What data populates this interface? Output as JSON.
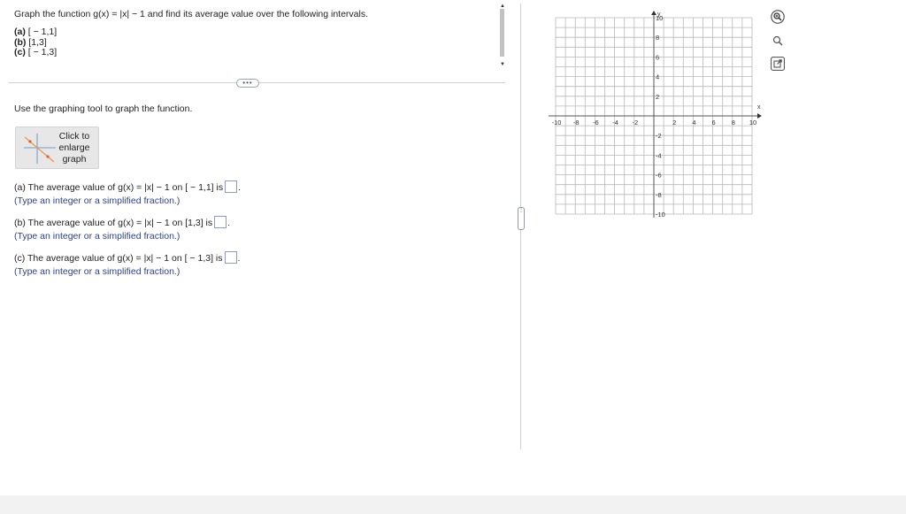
{
  "problem": {
    "statement": "Graph the function g(x) = |x| − 1 and find its average value over the following intervals.",
    "intervals": [
      {
        "label": "(a)",
        "value": "[ − 1,1]"
      },
      {
        "label": "(b)",
        "value": "[1,3]"
      },
      {
        "label": "(c)",
        "value": "[ − 1,3]"
      }
    ]
  },
  "more_pill": "•••",
  "instruction": "Use the graphing tool to graph the function.",
  "enlarge_button": {
    "label": "Click to enlarge graph"
  },
  "questions": [
    {
      "prefix": "(a) The average value of g(x) = |x| − 1 on [ − 1,1] is",
      "suffix": ".",
      "hint": "(Type an integer or a simplified fraction.)"
    },
    {
      "prefix": "(b) The average value of g(x) = |x| − 1 on [1,3] is",
      "suffix": ".",
      "hint": "(Type an integer or a simplified fraction.)"
    },
    {
      "prefix": "(c) The average value of g(x) = |x| − 1 on [ − 1,3] is",
      "suffix": ".",
      "hint": "(Type an integer or a simplified fraction.)"
    }
  ],
  "graph": {
    "x_axis_label": "x",
    "y_axis_label": "y",
    "x_range": [
      -10,
      10
    ],
    "y_range": [
      -10,
      10
    ],
    "x_tick_labels": [
      "-10",
      "-8",
      "-6",
      "-4",
      "-2",
      "2",
      "4",
      "6",
      "8",
      "10"
    ],
    "y_tick_labels": [
      "10",
      "8",
      "6",
      "4",
      "2",
      "-2",
      "-4",
      "-6",
      "-8",
      "-10"
    ],
    "grid": true
  },
  "tools": [
    "zoom-in-icon",
    "zoom-out-icon",
    "open-external-icon"
  ]
}
